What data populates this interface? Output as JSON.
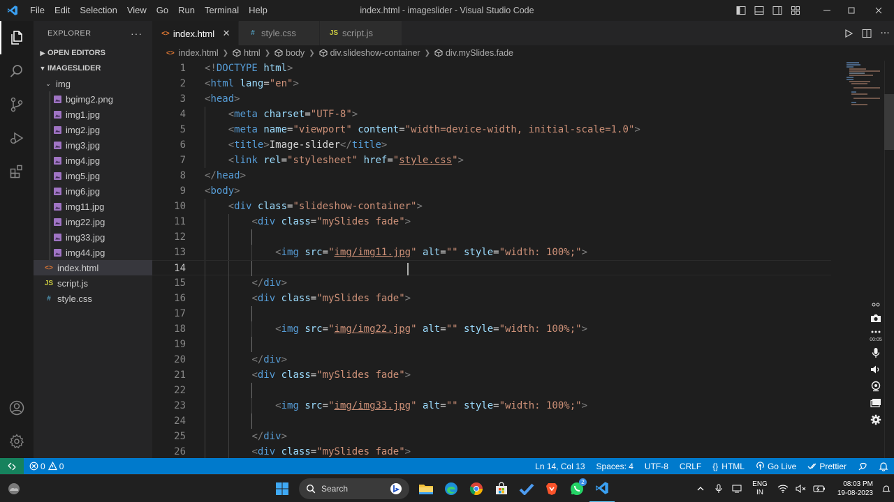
{
  "window": {
    "title": "index.html - imageslider - Visual Studio Code",
    "menu": [
      "File",
      "Edit",
      "Selection",
      "View",
      "Go",
      "Run",
      "Terminal",
      "Help"
    ]
  },
  "explorer": {
    "header": "EXPLORER",
    "more": "···",
    "open_editors": "OPEN EDITORS",
    "project": "IMAGESLIDER",
    "folder": "img",
    "images": [
      "bgimg2.png",
      "img1.jpg",
      "img2.jpg",
      "img3.jpg",
      "img4.jpg",
      "img5.jpg",
      "img6.jpg",
      "img11.jpg",
      "img22.jpg",
      "img33.jpg",
      "img44.jpg"
    ],
    "files": [
      {
        "name": "index.html",
        "icon": "html-file-icon",
        "glyph": "<>",
        "color": "#e37933"
      },
      {
        "name": "script.js",
        "icon": "js-file-icon",
        "glyph": "JS",
        "color": "#cbcb41"
      },
      {
        "name": "style.css",
        "icon": "css-file-icon",
        "glyph": "#",
        "color": "#519aba"
      }
    ]
  },
  "tabs": [
    {
      "label": "index.html",
      "glyph": "<>",
      "color": "#e37933",
      "active": true
    },
    {
      "label": "style.css",
      "glyph": "#",
      "color": "#519aba",
      "active": false
    },
    {
      "label": "script.js",
      "glyph": "JS",
      "color": "#cbcb41",
      "active": false
    }
  ],
  "breadcrumb": [
    "index.html",
    "html",
    "body",
    "div.slideshow-container",
    "div.mySlides.fade"
  ],
  "editor": {
    "current_line": 14,
    "lines": [
      {
        "n": 1,
        "indent": 0,
        "tokens": [
          [
            "br",
            "<!"
          ],
          [
            "tag",
            "DOCTYPE"
          ],
          [
            "txt",
            " "
          ],
          [
            "attr",
            "html"
          ],
          [
            "br",
            ">"
          ]
        ]
      },
      {
        "n": 2,
        "indent": 0,
        "tokens": [
          [
            "br",
            "<"
          ],
          [
            "tag",
            "html"
          ],
          [
            "txt",
            " "
          ],
          [
            "attr",
            "lang"
          ],
          [
            "txt",
            "="
          ],
          [
            "str",
            "\"en\""
          ],
          [
            "br",
            ">"
          ]
        ]
      },
      {
        "n": 3,
        "indent": 0,
        "tokens": [
          [
            "br",
            "<"
          ],
          [
            "tag",
            "head"
          ],
          [
            "br",
            ">"
          ]
        ]
      },
      {
        "n": 4,
        "indent": 1,
        "tokens": [
          [
            "br",
            "<"
          ],
          [
            "tag",
            "meta"
          ],
          [
            "txt",
            " "
          ],
          [
            "attr",
            "charset"
          ],
          [
            "txt",
            "="
          ],
          [
            "str",
            "\"UTF-8\""
          ],
          [
            "br",
            ">"
          ]
        ]
      },
      {
        "n": 5,
        "indent": 1,
        "tokens": [
          [
            "br",
            "<"
          ],
          [
            "tag",
            "meta"
          ],
          [
            "txt",
            " "
          ],
          [
            "attr",
            "name"
          ],
          [
            "txt",
            "="
          ],
          [
            "str",
            "\"viewport\""
          ],
          [
            "txt",
            " "
          ],
          [
            "attr",
            "content"
          ],
          [
            "txt",
            "="
          ],
          [
            "str",
            "\"width=device-width, initial-scale=1.0\""
          ],
          [
            "br",
            ">"
          ]
        ]
      },
      {
        "n": 6,
        "indent": 1,
        "tokens": [
          [
            "br",
            "<"
          ],
          [
            "tag",
            "title"
          ],
          [
            "br",
            ">"
          ],
          [
            "txt",
            "Image-slider"
          ],
          [
            "br",
            "</"
          ],
          [
            "tag",
            "title"
          ],
          [
            "br",
            ">"
          ]
        ]
      },
      {
        "n": 7,
        "indent": 1,
        "tokens": [
          [
            "br",
            "<"
          ],
          [
            "tag",
            "link"
          ],
          [
            "txt",
            " "
          ],
          [
            "attr",
            "rel"
          ],
          [
            "txt",
            "="
          ],
          [
            "str",
            "\"stylesheet\""
          ],
          [
            "txt",
            " "
          ],
          [
            "attr",
            "href"
          ],
          [
            "txt",
            "="
          ],
          [
            "str",
            "\""
          ],
          [
            "link",
            "style.css"
          ],
          [
            "str",
            "\""
          ],
          [
            "br",
            ">"
          ]
        ]
      },
      {
        "n": 8,
        "indent": 0,
        "tokens": [
          [
            "br",
            "</"
          ],
          [
            "tag",
            "head"
          ],
          [
            "br",
            ">"
          ]
        ]
      },
      {
        "n": 9,
        "indent": 0,
        "tokens": [
          [
            "br",
            "<"
          ],
          [
            "tag",
            "body"
          ],
          [
            "br",
            ">"
          ]
        ]
      },
      {
        "n": 10,
        "indent": 1,
        "tokens": [
          [
            "br",
            "<"
          ],
          [
            "tag",
            "div"
          ],
          [
            "txt",
            " "
          ],
          [
            "attr",
            "class"
          ],
          [
            "txt",
            "="
          ],
          [
            "str",
            "\"slideshow-container\""
          ],
          [
            "br",
            ">"
          ]
        ]
      },
      {
        "n": 11,
        "indent": 2,
        "tokens": [
          [
            "br",
            "<"
          ],
          [
            "tag",
            "div"
          ],
          [
            "txt",
            " "
          ],
          [
            "attr",
            "class"
          ],
          [
            "txt",
            "="
          ],
          [
            "str",
            "\"mySlides fade\""
          ],
          [
            "br",
            ">"
          ]
        ]
      },
      {
        "n": 12,
        "indent": 3,
        "tokens": []
      },
      {
        "n": 13,
        "indent": 3,
        "tokens": [
          [
            "br",
            "<"
          ],
          [
            "tag",
            "img"
          ],
          [
            "txt",
            " "
          ],
          [
            "attr",
            "src"
          ],
          [
            "txt",
            "="
          ],
          [
            "str",
            "\""
          ],
          [
            "link",
            "img/img11.jpg"
          ],
          [
            "str",
            "\""
          ],
          [
            "txt",
            " "
          ],
          [
            "attr",
            "alt"
          ],
          [
            "txt",
            "="
          ],
          [
            "str",
            "\"\""
          ],
          [
            "txt",
            " "
          ],
          [
            "attr",
            "style"
          ],
          [
            "txt",
            "="
          ],
          [
            "str",
            "\"width: 100%;\""
          ],
          [
            "br",
            ">"
          ]
        ]
      },
      {
        "n": 14,
        "indent": 3,
        "tokens": []
      },
      {
        "n": 15,
        "indent": 2,
        "tokens": [
          [
            "br",
            "</"
          ],
          [
            "tag",
            "div"
          ],
          [
            "br",
            ">"
          ]
        ]
      },
      {
        "n": 16,
        "indent": 2,
        "tokens": [
          [
            "br",
            "<"
          ],
          [
            "tag",
            "div"
          ],
          [
            "txt",
            " "
          ],
          [
            "attr",
            "class"
          ],
          [
            "txt",
            "="
          ],
          [
            "str",
            "\"mySlides fade\""
          ],
          [
            "br",
            ">"
          ]
        ]
      },
      {
        "n": 17,
        "indent": 3,
        "tokens": []
      },
      {
        "n": 18,
        "indent": 3,
        "tokens": [
          [
            "br",
            "<"
          ],
          [
            "tag",
            "img"
          ],
          [
            "txt",
            " "
          ],
          [
            "attr",
            "src"
          ],
          [
            "txt",
            "="
          ],
          [
            "str",
            "\""
          ],
          [
            "link",
            "img/img22.jpg"
          ],
          [
            "str",
            "\""
          ],
          [
            "txt",
            " "
          ],
          [
            "attr",
            "alt"
          ],
          [
            "txt",
            "="
          ],
          [
            "str",
            "\"\""
          ],
          [
            "txt",
            " "
          ],
          [
            "attr",
            "style"
          ],
          [
            "txt",
            "="
          ],
          [
            "str",
            "\"width: 100%;\""
          ],
          [
            "br",
            ">"
          ]
        ]
      },
      {
        "n": 19,
        "indent": 3,
        "tokens": []
      },
      {
        "n": 20,
        "indent": 2,
        "tokens": [
          [
            "br",
            "</"
          ],
          [
            "tag",
            "div"
          ],
          [
            "br",
            ">"
          ]
        ]
      },
      {
        "n": 21,
        "indent": 2,
        "tokens": [
          [
            "br",
            "<"
          ],
          [
            "tag",
            "div"
          ],
          [
            "txt",
            " "
          ],
          [
            "attr",
            "class"
          ],
          [
            "txt",
            "="
          ],
          [
            "str",
            "\"mySlides fade\""
          ],
          [
            "br",
            ">"
          ]
        ]
      },
      {
        "n": 22,
        "indent": 3,
        "tokens": []
      },
      {
        "n": 23,
        "indent": 3,
        "tokens": [
          [
            "br",
            "<"
          ],
          [
            "tag",
            "img"
          ],
          [
            "txt",
            " "
          ],
          [
            "attr",
            "src"
          ],
          [
            "txt",
            "="
          ],
          [
            "str",
            "\""
          ],
          [
            "link",
            "img/img33.jpg"
          ],
          [
            "str",
            "\""
          ],
          [
            "txt",
            " "
          ],
          [
            "attr",
            "alt"
          ],
          [
            "txt",
            "="
          ],
          [
            "str",
            "\"\""
          ],
          [
            "txt",
            " "
          ],
          [
            "attr",
            "style"
          ],
          [
            "txt",
            "="
          ],
          [
            "str",
            "\"width: 100%;\""
          ],
          [
            "br",
            ">"
          ]
        ]
      },
      {
        "n": 24,
        "indent": 3,
        "tokens": []
      },
      {
        "n": 25,
        "indent": 2,
        "tokens": [
          [
            "br",
            "</"
          ],
          [
            "tag",
            "div"
          ],
          [
            "br",
            ">"
          ]
        ]
      },
      {
        "n": 26,
        "indent": 2,
        "tokens": [
          [
            "br",
            "<"
          ],
          [
            "tag",
            "div"
          ],
          [
            "txt",
            " "
          ],
          [
            "attr",
            "class"
          ],
          [
            "txt",
            "="
          ],
          [
            "str",
            "\"mySlides fade\""
          ],
          [
            "br",
            ">"
          ]
        ]
      }
    ]
  },
  "recorder": {
    "time": "00:05"
  },
  "statusbar": {
    "errors": "0",
    "warnings": "0",
    "position": "Ln 14, Col 13",
    "spaces": "Spaces: 4",
    "encoding": "UTF-8",
    "eol": "CRLF",
    "language": "HTML",
    "live": "Go Live",
    "prettier": "Prettier"
  },
  "taskbar": {
    "search": "Search",
    "lang_top": "ENG",
    "lang_bottom": "IN",
    "time": "08:03 PM",
    "date": "19-08-2023",
    "whatsapp_badge": "2"
  },
  "colors": {
    "accent": "#007acc",
    "remote": "#16825d",
    "tag": "#569cd6",
    "attr": "#9cdcfe",
    "string": "#ce9178"
  }
}
